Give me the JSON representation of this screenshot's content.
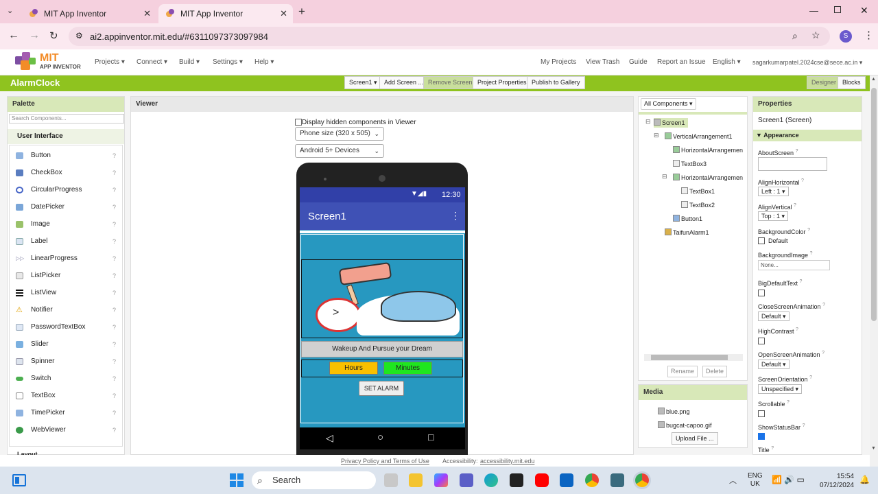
{
  "browser": {
    "tabs": [
      {
        "title": "MIT App Inventor",
        "active": false
      },
      {
        "title": "MIT App Inventor",
        "active": true
      }
    ],
    "url": "ai2.appinventor.mit.edu/#6311097373097984",
    "profile_initial": "S"
  },
  "header": {
    "logo_title": "MIT",
    "logo_subtitle": "APP INVENTOR",
    "menus": [
      "Projects ▾",
      "Connect ▾",
      "Build ▾",
      "Settings ▾",
      "Help ▾"
    ],
    "right_links": [
      "My Projects",
      "View Trash",
      "Guide",
      "Report an Issue",
      "English ▾",
      "sagarkumarpatel.2024cse@sece.ac.in ▾"
    ]
  },
  "project_bar": {
    "name": "AlarmClock",
    "screen_select": "Screen1 ▾",
    "add_screen": "Add Screen ...",
    "remove_screen": "Remove Screen",
    "project_properties": "Project Properties",
    "publish": "Publish to Gallery",
    "designer": "Designer",
    "blocks": "Blocks"
  },
  "palette": {
    "title": "Palette",
    "search_placeholder": "Search Components...",
    "category": "User Interface",
    "items": [
      "Button",
      "CheckBox",
      "CircularProgress",
      "DatePicker",
      "Image",
      "Label",
      "LinearProgress",
      "ListPicker",
      "ListView",
      "Notifier",
      "PasswordTextBox",
      "Slider",
      "Spinner",
      "Switch",
      "TextBox",
      "TimePicker",
      "WebViewer"
    ],
    "help_glyph": "?",
    "next_category": "Layout"
  },
  "viewer": {
    "title": "Viewer",
    "hidden_label": "Display hidden components in Viewer",
    "size_select": "Phone size (320 x 505)",
    "device_select": "Android 5+ Devices",
    "time": "12:30",
    "screen_title": "Screen1",
    "menu_glyph": "⋮",
    "banner_text": "Wakeup And Pursue your Dream",
    "hours_btn": "Hours",
    "minutes_btn": "Minutes",
    "set_alarm_btn": "SET ALARM",
    "nav": [
      "◁",
      "○",
      "□"
    ]
  },
  "components": {
    "dropdown": "All Components ▾",
    "tree": [
      {
        "label": "Screen1",
        "level": 0,
        "toggle": "⊟"
      },
      {
        "label": "VerticalArrangement1",
        "level": 1,
        "toggle": "⊟"
      },
      {
        "label": "HorizontalArrangemen",
        "level": 2,
        "toggle": ""
      },
      {
        "label": "TextBox3",
        "level": 2,
        "toggle": ""
      },
      {
        "label": "HorizontalArrangemen",
        "level": 2,
        "toggle": "⊟"
      },
      {
        "label": "TextBox1",
        "level": 3,
        "toggle": ""
      },
      {
        "label": "TextBox2",
        "level": 3,
        "toggle": ""
      },
      {
        "label": "Button1",
        "level": 2,
        "toggle": ""
      },
      {
        "label": "TaifunAlarm1",
        "level": 1,
        "toggle": ""
      }
    ],
    "rename": "Rename",
    "delete": "Delete"
  },
  "media": {
    "title": "Media",
    "files": [
      "blue.png",
      "bugcat-capoo.gif"
    ],
    "upload": "Upload File ..."
  },
  "properties": {
    "title": "Properties",
    "component": "Screen1 (Screen)",
    "section": "Appearance",
    "about": "AboutScreen",
    "align_h": "AlignHorizontal",
    "align_h_val": "Left : 1 ▾",
    "align_v": "AlignVertical",
    "align_v_val": "Top : 1 ▾",
    "bg_color": "BackgroundColor",
    "bg_color_val": "Default",
    "bg_image": "BackgroundImage",
    "bg_image_val": "None...",
    "big_text": "BigDefaultText",
    "close_anim": "CloseScreenAnimation",
    "close_anim_val": "Default ▾",
    "high_contrast": "HighContrast",
    "open_anim": "OpenScreenAnimation",
    "open_anim_val": "Default ▾",
    "orientation": "ScreenOrientation",
    "orientation_val": "Unspecified ▾",
    "scrollable": "Scrollable",
    "status_bar": "ShowStatusBar",
    "title_prop": "Title",
    "help_glyph": "?"
  },
  "footer": {
    "privacy": "Privacy Policy and Terms of Use",
    "accessibility_label": "Accessibility:",
    "accessibility_link": "accessibility.mit.edu"
  },
  "taskbar": {
    "search_placeholder": "Search",
    "lang1": "ENG",
    "lang2": "UK",
    "time": "15:54",
    "date": "07/12/2024"
  }
}
